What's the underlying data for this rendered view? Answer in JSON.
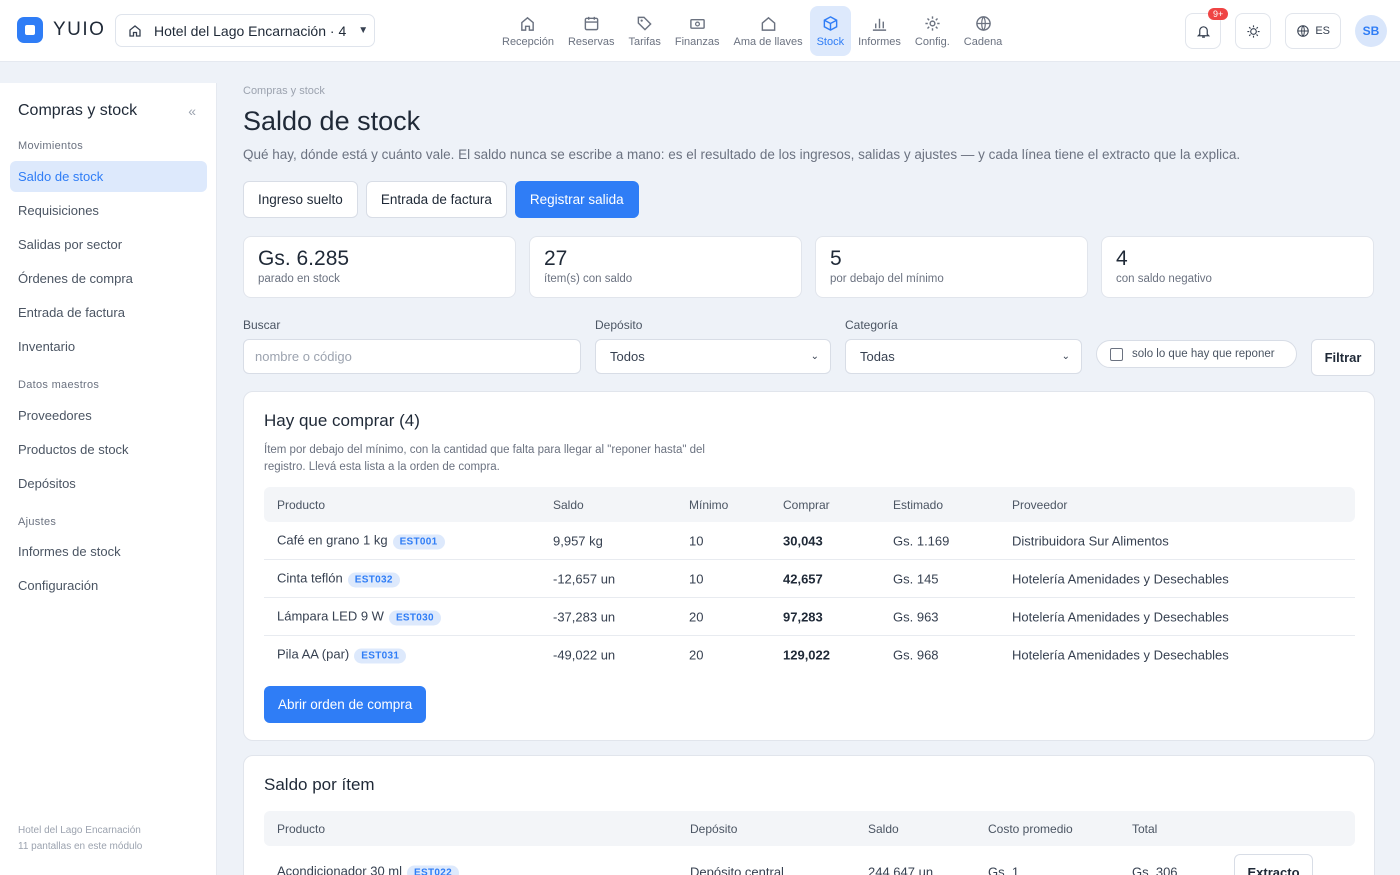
{
  "app": {
    "name": "YUIO",
    "hotel": "Hotel del Lago Encarnación · 4"
  },
  "nav": [
    {
      "label": "Recepción",
      "icon": "reception-icon"
    },
    {
      "label": "Reservas",
      "icon": "calendar-icon"
    },
    {
      "label": "Tarifas",
      "icon": "tag-icon"
    },
    {
      "label": "Finanzas",
      "icon": "cash-icon"
    },
    {
      "label": "Ama de llaves",
      "icon": "house-icon"
    },
    {
      "label": "Stock",
      "icon": "box-icon",
      "active": true
    },
    {
      "label": "Informes",
      "icon": "bar-chart-icon"
    },
    {
      "label": "Config.",
      "icon": "gear-icon"
    },
    {
      "label": "Cadena",
      "icon": "globe-icon"
    }
  ],
  "topright": {
    "notifications_badge": "9+",
    "language": "ES",
    "avatar": "SB"
  },
  "sidebar": {
    "title": "Compras y stock",
    "collapse": "«",
    "groups": [
      "Movimientos",
      "Datos maestros",
      "Ajustes"
    ],
    "items": [
      "Saldo de stock",
      "Requisiciones",
      "Salidas por sector",
      "Órdenes de compra",
      "Entrada de factura",
      "Inventario",
      "Proveedores",
      "Productos de stock",
      "Depósitos",
      "Informes de stock",
      "Configuración"
    ],
    "footer_hotel": "Hotel del Lago Encarnación",
    "footer_count": "11 pantallas en este módulo"
  },
  "page": {
    "breadcrumb": "Compras y stock",
    "title": "Saldo de stock",
    "subtitle": "Qué hay, dónde está y cuánto vale. El saldo nunca se escribe a mano: es el resultado de los ingresos, salidas y ajustes — y cada línea tiene el extracto que la explica.",
    "actions": [
      "Ingreso suelto",
      "Entrada de factura",
      "Registrar salida"
    ]
  },
  "stats": [
    {
      "value": "Gs. 6.285",
      "label": "parado en stock"
    },
    {
      "value": "27",
      "label": "ítem(s) con saldo"
    },
    {
      "value": "5",
      "label": "por debajo del mínimo"
    },
    {
      "value": "4",
      "label": "con saldo negativo"
    }
  ],
  "filters": {
    "search_label": "Buscar",
    "search_placeholder": "nombre o código",
    "deposit_label": "Depósito",
    "deposit_value": "Todos",
    "category_label": "Categoría",
    "category_value": "Todas",
    "reorder_only": "solo lo que hay que reponer",
    "filter_button": "Filtrar"
  },
  "buy": {
    "title": "Hay que comprar (4)",
    "description": "Ítem por debajo del mínimo, con la cantidad que falta para llegar al \"reponer hasta\" del registro. Llevá esta lista a la orden de compra.",
    "headers": [
      "Producto",
      "Saldo",
      "Mínimo",
      "Comprar",
      "Estimado",
      "Proveedor"
    ],
    "rows": [
      {
        "product": "Café en grano 1 kg",
        "code": "EST001",
        "balance": "9,957 kg",
        "min": "10",
        "buy": "30,043",
        "estimate": "Gs. 1.169",
        "supplier": "Distribuidora Sur Alimentos"
      },
      {
        "product": "Cinta teflón",
        "code": "EST032",
        "balance": "-12,657 un",
        "min": "10",
        "buy": "42,657",
        "estimate": "Gs. 145",
        "supplier": "Hotelería Amenidades y Desechables"
      },
      {
        "product": "Lámpara LED 9 W",
        "code": "EST030",
        "balance": "-37,283 un",
        "min": "20",
        "buy": "97,283",
        "estimate": "Gs. 963",
        "supplier": "Hotelería Amenidades y Desechables"
      },
      {
        "product": "Pila AA (par)",
        "code": "EST031",
        "balance": "-49,022 un",
        "min": "20",
        "buy": "129,022",
        "estimate": "Gs. 968",
        "supplier": "Hotelería Amenidades y Desechables"
      }
    ],
    "button": "Abrir orden de compra"
  },
  "balance": {
    "title": "Saldo por ítem",
    "headers": [
      "Producto",
      "Depósito",
      "Saldo",
      "Costo promedio",
      "Total"
    ],
    "rows": [
      {
        "product": "Acondicionador 30 ml",
        "code": "EST022",
        "deposit": "Depósito central",
        "balance": "244,647 un",
        "avg_cost": "Gs. 1",
        "total": "Gs. 306",
        "action": "Extracto"
      }
    ]
  }
}
